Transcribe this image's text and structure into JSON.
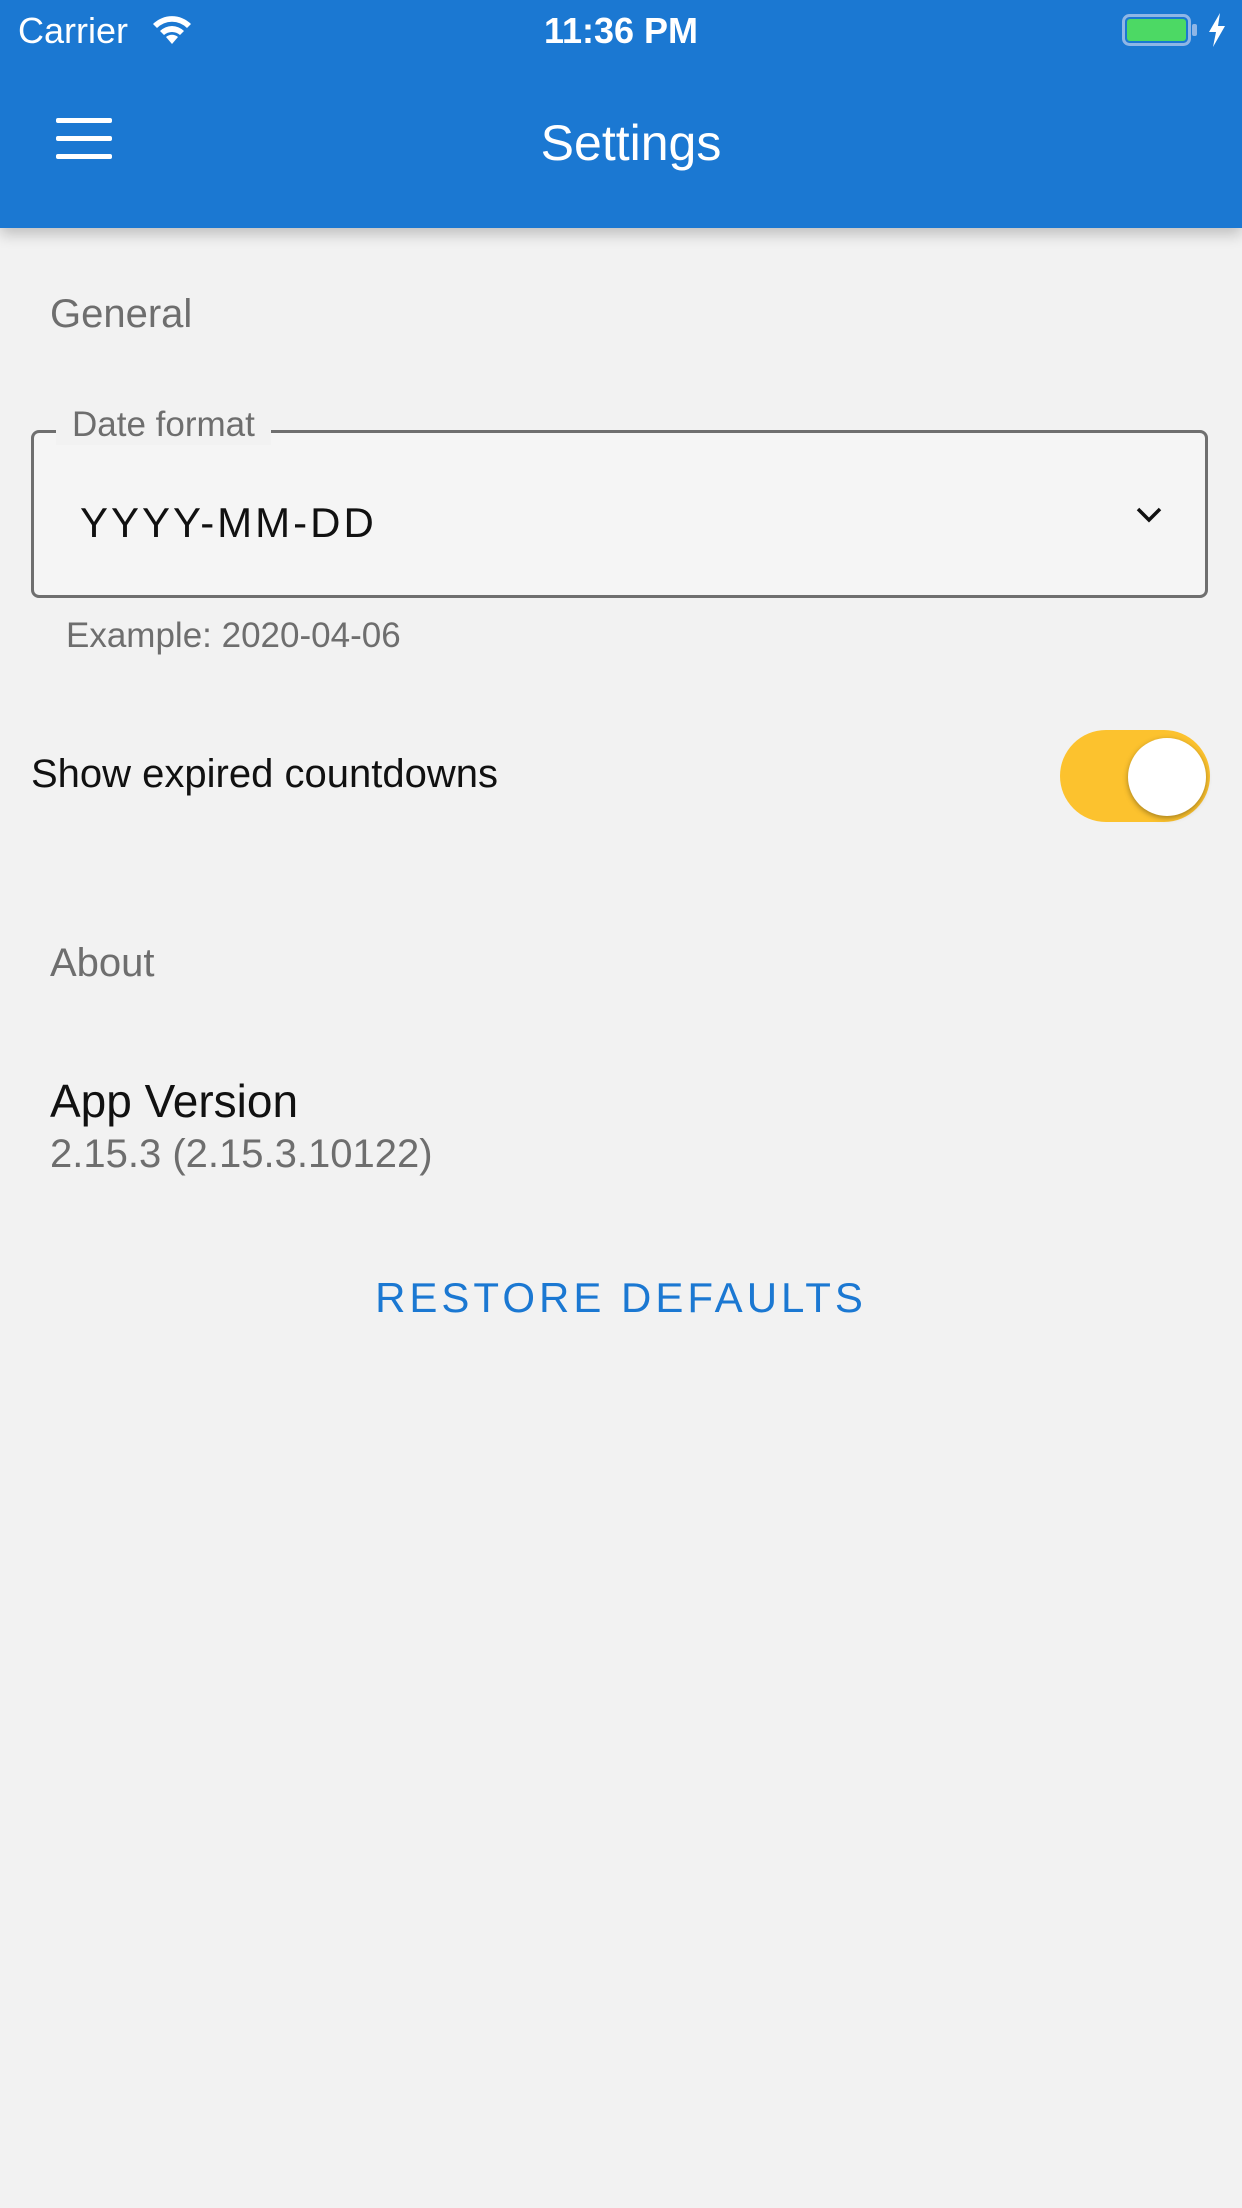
{
  "status_bar": {
    "carrier": "Carrier",
    "time": "11:36 PM",
    "wifi_icon": "wifi-icon",
    "battery_icon": "battery-charging-icon",
    "battery_color": "#4cd964"
  },
  "header": {
    "title": "Settings",
    "menu_icon": "hamburger-menu-icon",
    "background": "#1b78d2"
  },
  "general": {
    "section_label": "General",
    "date_format": {
      "label": "Date format",
      "value": "YYYY-MM-DD",
      "helper": "Example: 2020-04-06",
      "icon": "chevron-down-icon"
    },
    "show_expired": {
      "label": "Show expired countdowns",
      "enabled": true,
      "accent": "#fcc22e"
    }
  },
  "about": {
    "section_label": "About",
    "app_version_title": "App Version",
    "app_version_value": "2.15.3 (2.15.3.10122)"
  },
  "actions": {
    "restore_label": "RESTORE DEFAULTS"
  }
}
